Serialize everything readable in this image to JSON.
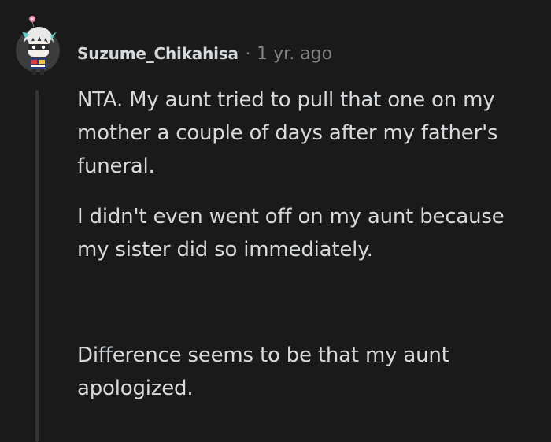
{
  "comment": {
    "author": "Suzume_Chikahisa",
    "separator": "·",
    "timestamp": "1 yr. ago",
    "paragraphs": [
      "NTA. My aunt tried to pull that one on my mother a couple of days after my father's funeral.",
      "I didn't even went off on my aunt because my sister did so immediately.",
      "Difference seems to be that my aunt apologized."
    ]
  },
  "colors": {
    "background": "#1a1a1b",
    "text": "#d7dadc",
    "muted": "#818384",
    "thread_line": "#343536"
  },
  "icons": {
    "avatar": "user-avatar-icon"
  }
}
